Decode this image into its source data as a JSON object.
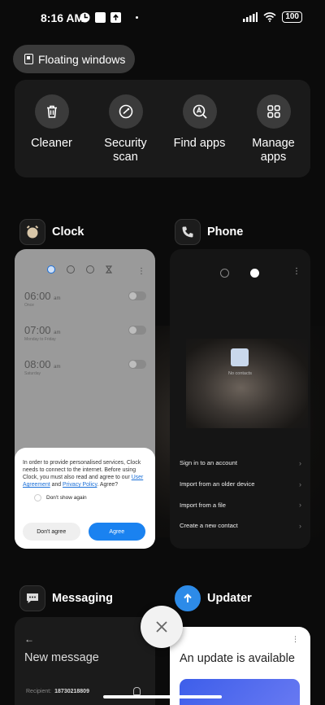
{
  "status_bar": {
    "time": "8:16 AM",
    "battery": "100"
  },
  "floating_windows": {
    "label": "Floating windows"
  },
  "quick_actions": [
    {
      "label": "Cleaner",
      "icon": "trash-icon"
    },
    {
      "label": "Security scan",
      "icon": "shield-check-icon"
    },
    {
      "label": "Find apps",
      "icon": "search-apps-icon"
    },
    {
      "label": "Manage apps",
      "icon": "grid-icon"
    }
  ],
  "apps": {
    "clock": {
      "name": "Clock",
      "alarms": [
        {
          "time": "06:00",
          "ampm": "am",
          "sub": "Once"
        },
        {
          "time": "07:00",
          "ampm": "am",
          "sub": "Monday to Friday"
        },
        {
          "time": "08:00",
          "ampm": "am",
          "sub": "Saturday"
        }
      ],
      "dialog": {
        "message_prefix": "In order to provide personalised services, Clock needs to connect to the internet. Before using Clock, you must also read and agree to our ",
        "link1": "User Agreement",
        "and": " and ",
        "link2": "Privacy Policy",
        "suffix": ". Agree?",
        "checkbox": "Don't show again",
        "disagree": "Don't agree",
        "agree": "Agree"
      }
    },
    "phone": {
      "name": "Phone",
      "no_contacts": "No contacts",
      "options": [
        "Sign in to an account",
        "Import from an older device",
        "Import from a file",
        "Create a new contact"
      ]
    },
    "messaging": {
      "name": "Messaging",
      "title": "New message",
      "recipient_label": "Recipient:",
      "recipient_value": "18730218809"
    },
    "updater": {
      "name": "Updater",
      "title": "An update is available"
    }
  },
  "colors": {
    "accent": "#1a82f0",
    "background": "#0b0b0b"
  }
}
